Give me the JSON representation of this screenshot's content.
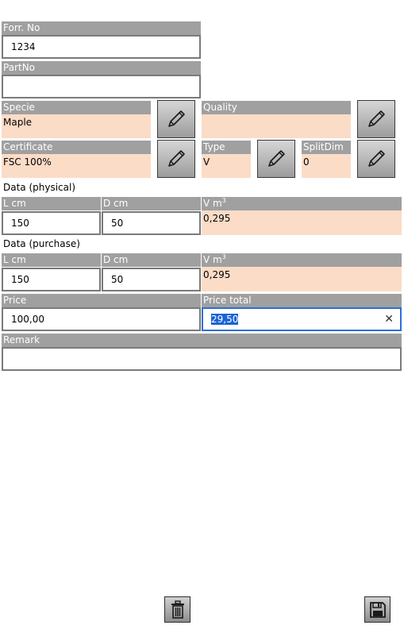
{
  "fields": {
    "forr_no": {
      "label": "Forr. No",
      "value": "1234"
    },
    "part_no": {
      "label": "PartNo",
      "value": ""
    },
    "specie": {
      "label": "Specie",
      "value": "Maple"
    },
    "quality": {
      "label": "Quality",
      "value": ""
    },
    "certificate": {
      "label": "Certificate",
      "value": "FSC 100%"
    },
    "type": {
      "label": "Type",
      "value": "V"
    },
    "split_dim": {
      "label": "SplitDim",
      "value": "0"
    }
  },
  "physical": {
    "section_label": "Data (physical)",
    "l_label": "L cm",
    "l_value": "150",
    "d_label": "D cm",
    "d_value": "50",
    "v_label": "V m",
    "v_unit_sup": "3",
    "v_value": "0,295"
  },
  "purchase": {
    "section_label": "Data (purchase)",
    "l_label": "L cm",
    "l_value": "150",
    "d_label": "D cm",
    "d_value": "50",
    "v_label": "V m",
    "v_unit_sup": "3",
    "v_value": "0,295"
  },
  "price": {
    "label": "Price",
    "value": "100,00"
  },
  "price_total": {
    "label": "Price total",
    "value": "29,50",
    "clear_icon": "close-icon"
  },
  "remark": {
    "label": "Remark",
    "value": ""
  },
  "toolbar": {
    "delete_icon": "trash-icon",
    "save_icon": "save-icon"
  },
  "colors": {
    "header": "#a0a0a0",
    "value_bg": "#fbdcc7",
    "focus": "#2a6fd8",
    "selection": "#1a64d8"
  }
}
